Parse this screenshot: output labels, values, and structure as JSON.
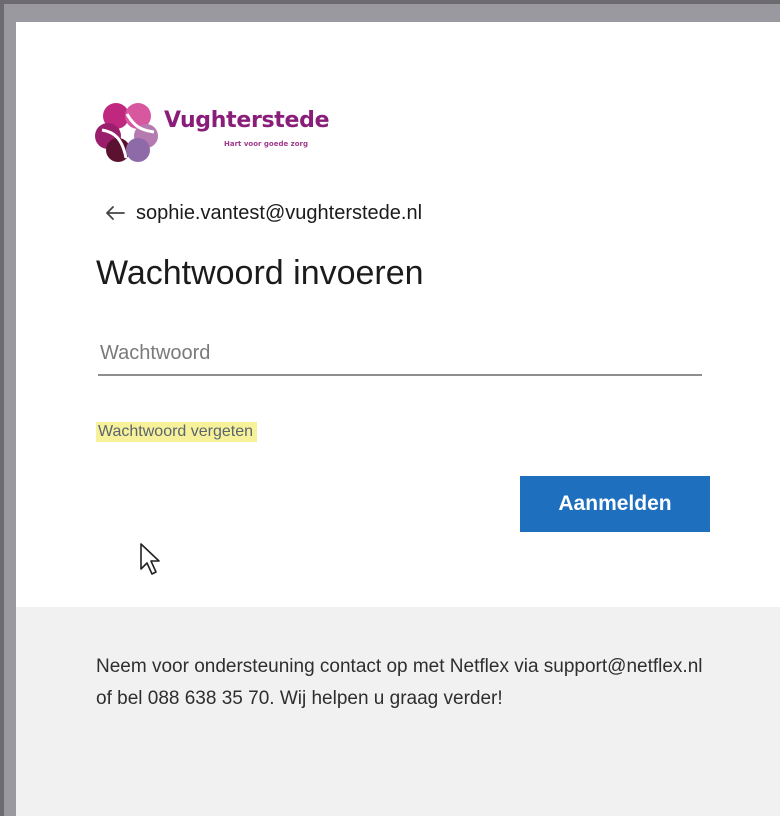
{
  "brand": {
    "name": "Vughterstede",
    "tagline": "Hart voor goede zorg",
    "colors": {
      "primary": "#8a1d7a",
      "dark": "#5b1230",
      "light": "#b57ab0"
    }
  },
  "header": {
    "back_icon": "arrow-left-icon",
    "identity": "sophie.vantest@vughterstede.nl"
  },
  "main": {
    "title": "Wachtwoord invoeren",
    "password_placeholder": "Wachtwoord",
    "password_value": "",
    "forgot_link": "Wachtwoord vergeten",
    "signin_button": "Aanmelden",
    "accent_color": "#1f6fbf",
    "highlight_color": "#f7f29a"
  },
  "footer": {
    "text": "Neem voor ondersteuning contact op met Netflex via support@netflex.nl of bel 088 638 35 70. Wij helpen u graag verder!"
  },
  "cursor": {
    "icon": "mouse-pointer-icon"
  }
}
